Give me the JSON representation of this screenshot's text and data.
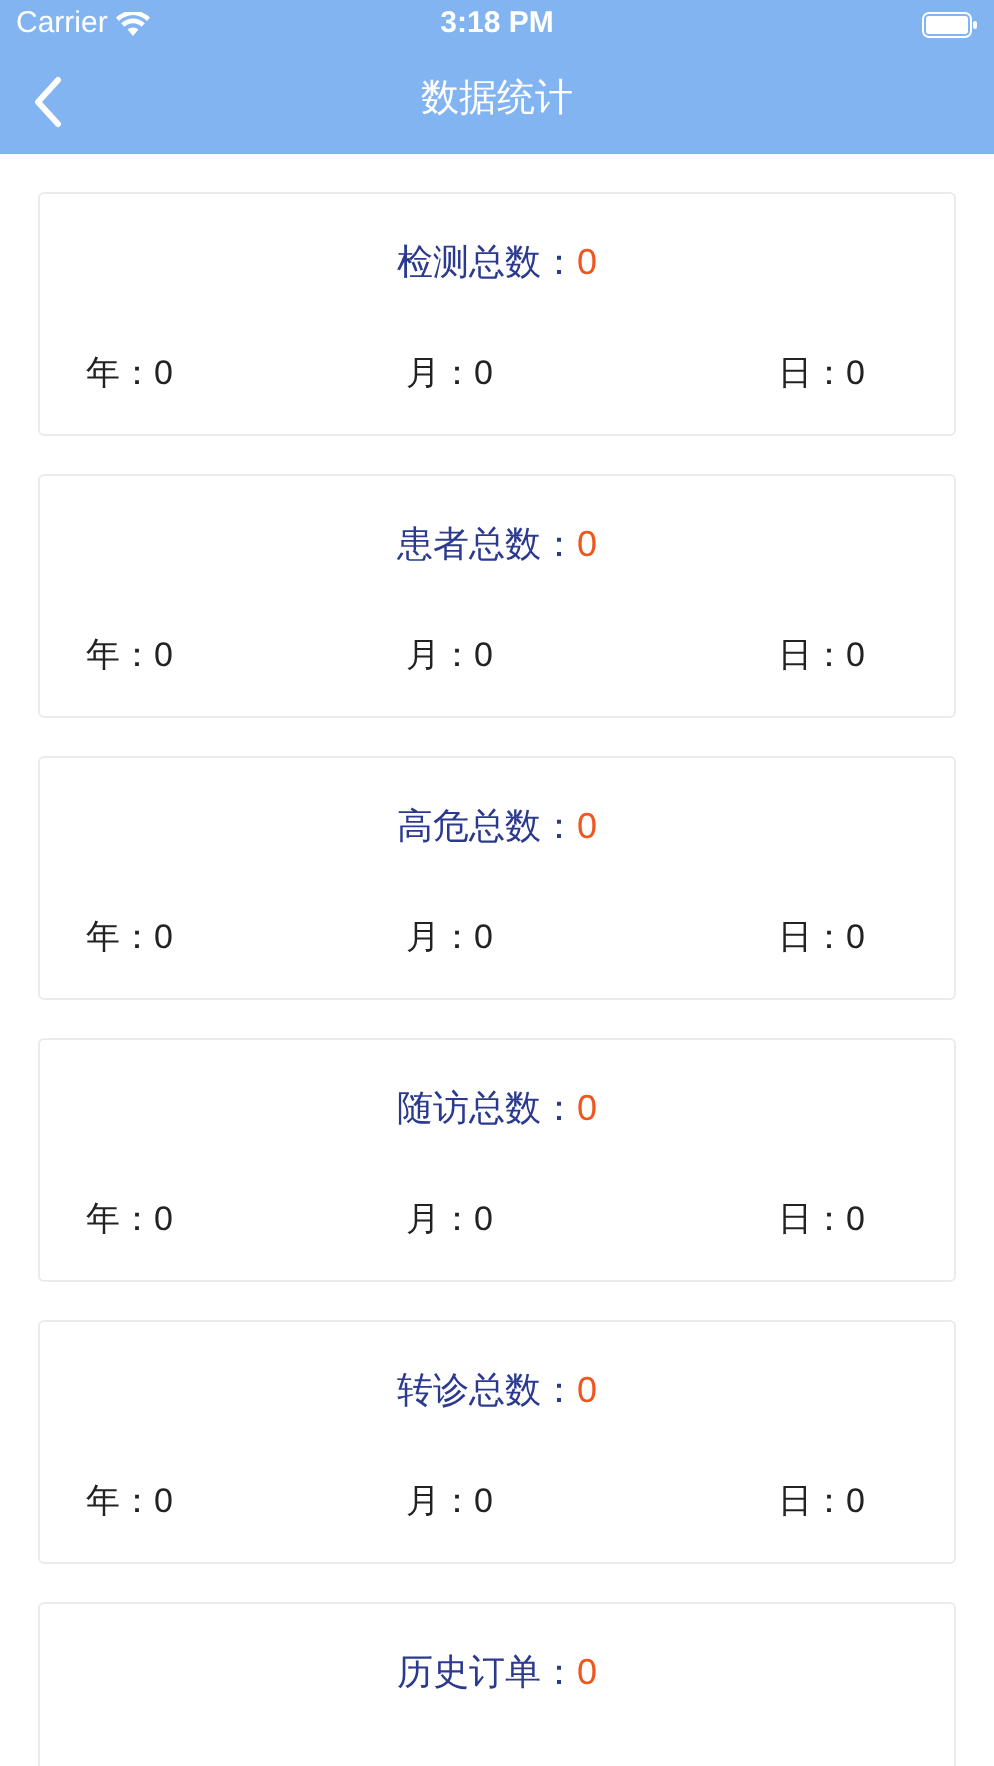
{
  "status_bar": {
    "carrier": "Carrier",
    "time": "3:18 PM"
  },
  "nav": {
    "title": "数据统计"
  },
  "cards": [
    {
      "label": "检测总数：",
      "value": "0",
      "stats": [
        "年：0",
        "月：0",
        "日：0"
      ]
    },
    {
      "label": "患者总数：",
      "value": "0",
      "stats": [
        "年：0",
        "月：0",
        "日：0"
      ]
    },
    {
      "label": "高危总数：",
      "value": "0",
      "stats": [
        "年：0",
        "月：0",
        "日：0"
      ]
    },
    {
      "label": "随访总数：",
      "value": "0",
      "stats": [
        "年：0",
        "月：0",
        "日：0"
      ]
    },
    {
      "label": "转诊总数：",
      "value": "0",
      "stats": [
        "年：0",
        "月：0",
        "日：0"
      ]
    },
    {
      "label": "历史订单：",
      "value": "0"
    }
  ]
}
